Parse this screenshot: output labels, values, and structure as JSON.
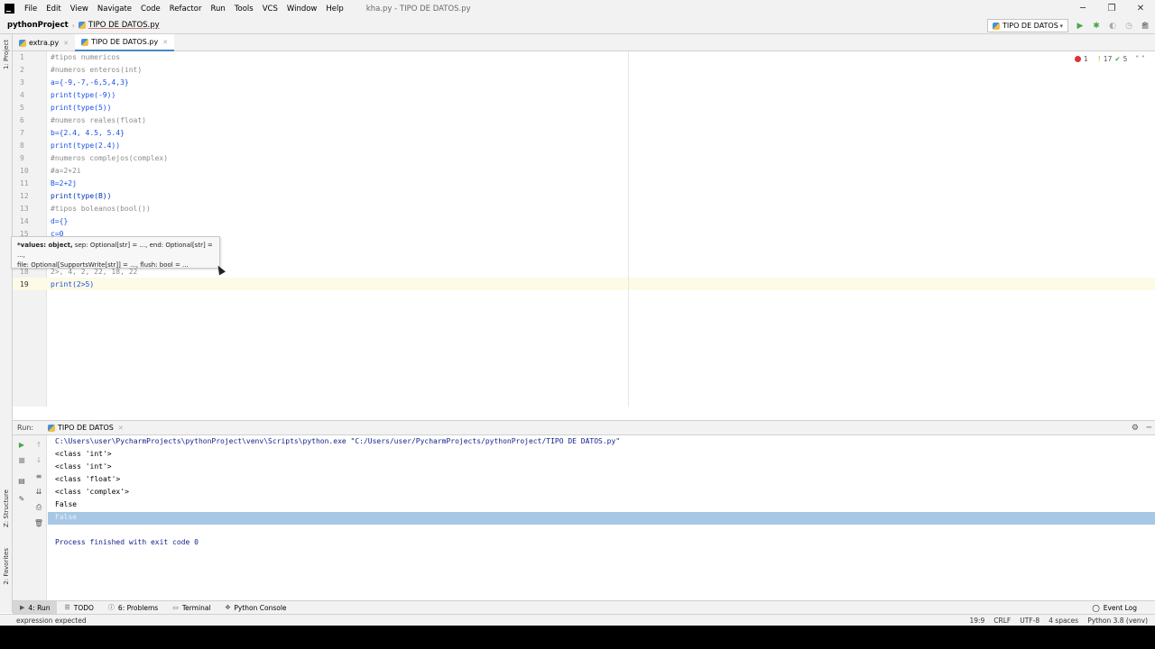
{
  "menu": [
    "File",
    "Edit",
    "View",
    "Navigate",
    "Code",
    "Refactor",
    "Run",
    "Tools",
    "VCS",
    "Window",
    "Help"
  ],
  "window_title": "kha.py - TIPO DE DATOS.py",
  "window_controls": {
    "minimize": "─",
    "maximize": "❐",
    "close": "✕"
  },
  "breadcrumb": {
    "project": "pythonProject",
    "file": "TIPO DE DATOS.py"
  },
  "run_config": "TIPO DE DATOS",
  "side_labels": {
    "project": "1: Project",
    "structure": "Z: Structure",
    "favorites": "2: Favorites"
  },
  "tabs": [
    {
      "label": "extra.py"
    },
    {
      "label": "TIPO DE DATOS.py"
    }
  ],
  "inspections": {
    "errors": "1",
    "warnings": "17",
    "ok": "5"
  },
  "editor": {
    "lines": [
      {
        "n": "1",
        "text": "#tipos numericos",
        "kind": "comment"
      },
      {
        "n": "2",
        "text": "#numeros enteros(int)",
        "kind": "comment"
      },
      {
        "n": "3",
        "text": "a={-9,-7,-6,5,4,3}",
        "kind": "code"
      },
      {
        "n": "4",
        "text": "print(type(-9))",
        "kind": "code"
      },
      {
        "n": "5",
        "text": "print(type(5))",
        "kind": "code"
      },
      {
        "n": "6",
        "text": "#numeros reales(float)",
        "kind": "comment"
      },
      {
        "n": "7",
        "text": "b={2.4, 4.5, 5.4}",
        "kind": "code"
      },
      {
        "n": "8",
        "text": "print(type(2.4))",
        "kind": "code"
      },
      {
        "n": "9",
        "text": "#numeros complejos(complex)",
        "kind": "comment"
      },
      {
        "n": "10",
        "text": "#a=2+2i",
        "kind": "comment"
      },
      {
        "n": "11",
        "text": "B=2+2j",
        "kind": "code"
      },
      {
        "n": "12",
        "text": "print(type(B))",
        "kind": "code"
      },
      {
        "n": "13",
        "text": "#tipos boleanos(bool())",
        "kind": "comment"
      },
      {
        "n": "14",
        "text": "d={}",
        "kind": "code"
      },
      {
        "n": "15",
        "text": "c=0",
        "kind": "code"
      },
      {
        "n": "18",
        "text": "2>, 4, 2, 22, 18, 22",
        "kind": "comment"
      },
      {
        "n": "19",
        "text": "print(2>5)",
        "kind": "code"
      }
    ],
    "tooltip": {
      "line1_bold": "*values: object,",
      "line1_rest": " sep: Optional[str] = ..., end: Optional[str] = ...,",
      "line2": "file: Optional[SupportsWrite[str]] = ..., flush: bool = ..."
    }
  },
  "run_panel": {
    "label": "Run:",
    "tab": "TIPO DE DATOS",
    "output": [
      "C:\\Users\\user\\PycharmProjects\\pythonProject\\venv\\Scripts\\python.exe \"C:/Users/user/PycharmProjects/pythonProject/TIPO DE DATOS.py\"",
      "<class 'int'>",
      "<class 'int'>",
      "<class 'float'>",
      "<class 'complex'>",
      "False",
      "False",
      "",
      "Process finished with exit code 0"
    ]
  },
  "bottom_tabs": [
    "4: Run",
    "TODO",
    "6: Problems",
    "Terminal",
    "Python Console"
  ],
  "event_log": "Event Log",
  "status": {
    "message": "expression expected",
    "position": "19:9",
    "line_sep": "CRLF",
    "encoding": "UTF-8",
    "indent": "4 spaces",
    "interpreter": "Python 3.8 (venv)"
  }
}
